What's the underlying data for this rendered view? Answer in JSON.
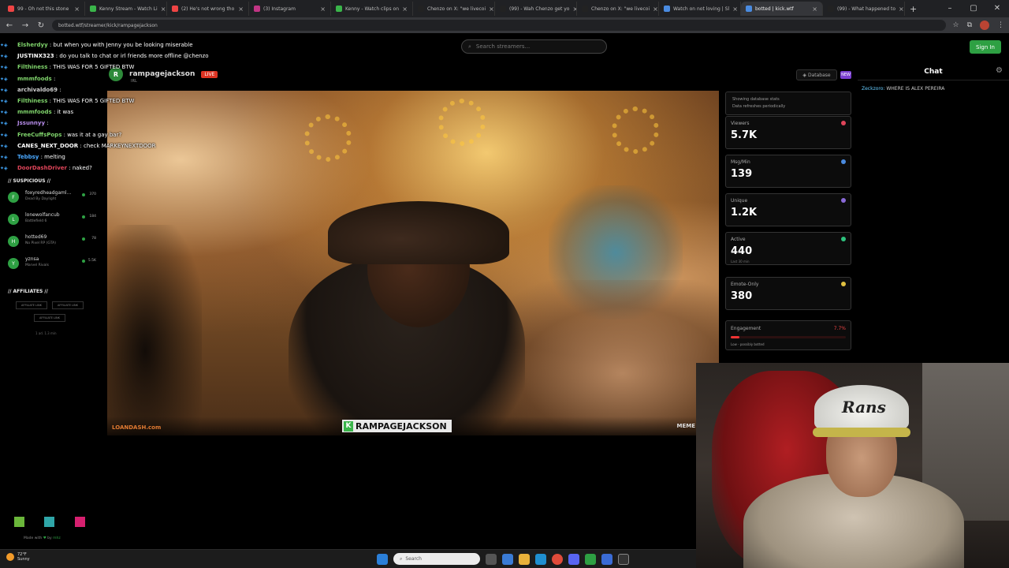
{
  "browser": {
    "tabs": [
      {
        "label": "99 - Oh not this stone"
      },
      {
        "label": "Kenny Stream - Watch Li"
      },
      {
        "label": "(2) He's not wrong tho"
      },
      {
        "label": "(3) Instagram"
      },
      {
        "label": "Kenny - Watch clips on"
      },
      {
        "label": "Chenzo on X: \"we livecoi"
      },
      {
        "label": "(99) - Wah Chenzo get yo"
      },
      {
        "label": "Chenzo on X: \"we livecoi"
      },
      {
        "label": "Watch on not loving | Sl"
      },
      {
        "label": "botted | kick.wtf"
      },
      {
        "label": "(99) - What happened to"
      }
    ],
    "active_tab": 9,
    "url": "botted.wtf/streamer/kick/rampagejackson"
  },
  "header": {
    "search_placeholder": "Search streamers...",
    "sign_in": "Sign In"
  },
  "chat": {
    "title": "Chat",
    "message_user": "Zeckzoro:",
    "message_text": "WHERE IS ALEX PEREIRA"
  },
  "stream": {
    "avatar_letter": "R",
    "streamer": "rampagejackson",
    "live": "LIVE",
    "category": "IRL",
    "database_label": "◈ Database",
    "tag_label": "NEW"
  },
  "video": {
    "sponsor": "LOANDASH.com",
    "name_tag": "RAMPAGEJACKSON",
    "watermark": "MEME"
  },
  "stats": {
    "note_line1": "Showing database stats",
    "note_line2": "Data refreshes periodically",
    "cards": [
      {
        "label": "Viewers",
        "value": "5.7K",
        "sub": "",
        "color": "#e0455a"
      },
      {
        "label": "Msg/Min",
        "value": "139",
        "sub": "",
        "color": "#4a8be0"
      },
      {
        "label": "Unique",
        "value": "1.2K",
        "sub": "",
        "color": "#8a6ad8"
      },
      {
        "label": "Active",
        "value": "440",
        "sub": "Last 30 min",
        "color": "#2ec27e"
      },
      {
        "label": "Emote-Only",
        "value": "380",
        "sub": "",
        "color": "#e0c040"
      }
    ],
    "engagement_label": "Engagement",
    "engagement_value": "7.7%",
    "engagement_fraction": 0.077,
    "engagement_note": "Low - possibly botted"
  },
  "chat_overlay": [
    {
      "user": "Elsherdyy",
      "text": "but when you with Jenny you be looking miserable",
      "color": "#7fd36b"
    },
    {
      "user": "JUSTINX323",
      "text": "do you talk to chat or irl friends more offline @chenzo",
      "color": "#ffffff"
    },
    {
      "user": "Filthiness",
      "text": "THIS WAS FOR 5 GIFTED BTW",
      "color": "#7fd36b"
    },
    {
      "user": "mmmfoods",
      "text": "",
      "color": "#7fd36b"
    },
    {
      "user": "archivaldo69",
      "text": "",
      "color": "#cfcfcf"
    },
    {
      "user": "Filthiness",
      "text": "THIS WAS FOR 5 GIFTED BTW",
      "color": "#7fd36b"
    },
    {
      "user": "mmmfoods",
      "text": "it was",
      "color": "#7fd36b"
    },
    {
      "user": "Jssunnyy",
      "text": "",
      "color": "#b58be8"
    },
    {
      "user": "FreeCuffsPops",
      "text": "was it at a gay bar?",
      "color": "#7fd36b"
    },
    {
      "user": "CANES_NEXT_DOOR",
      "text": "check MARKEYNEXTDOOR",
      "color": "#ffffff"
    },
    {
      "user": "Tebbsy",
      "text": "melting",
      "color": "#4aa8ff"
    },
    {
      "user": "DoorDashDriver",
      "text": "naked?",
      "color": "#e0455a"
    }
  ],
  "suspicious": {
    "title": "// SUSPICIOUS //",
    "items": [
      {
        "letter": "F",
        "name": "foxyredheadgaml...",
        "game": "Dead By Daylight",
        "count": "370"
      },
      {
        "letter": "L",
        "name": "lonewolfancub",
        "game": "Battlefield 6",
        "count": "184"
      },
      {
        "letter": "H",
        "name": "hotted69",
        "game": "No Pixel RP (GTA)",
        "count": "78"
      },
      {
        "letter": "Y",
        "name": "yznsa",
        "game": "Marvel Rivals",
        "count": "5.5K"
      }
    ]
  },
  "affiliates": {
    "title": "// AFFILIATES //",
    "buttons": [
      "AFFILIATE LINK",
      "AFFILIATE LINK",
      "AFFILIATE LINK"
    ],
    "note": "1 ad. 1.3 min"
  },
  "footer": {
    "made_with": "Made with",
    "by": "by",
    "author": "mhz",
    "colors": [
      "#6ab63a",
      "#2fa6a8",
      "#d6206f"
    ]
  },
  "taskbar": {
    "temp": "72°F",
    "condition": "Sunny",
    "search": "Search"
  }
}
